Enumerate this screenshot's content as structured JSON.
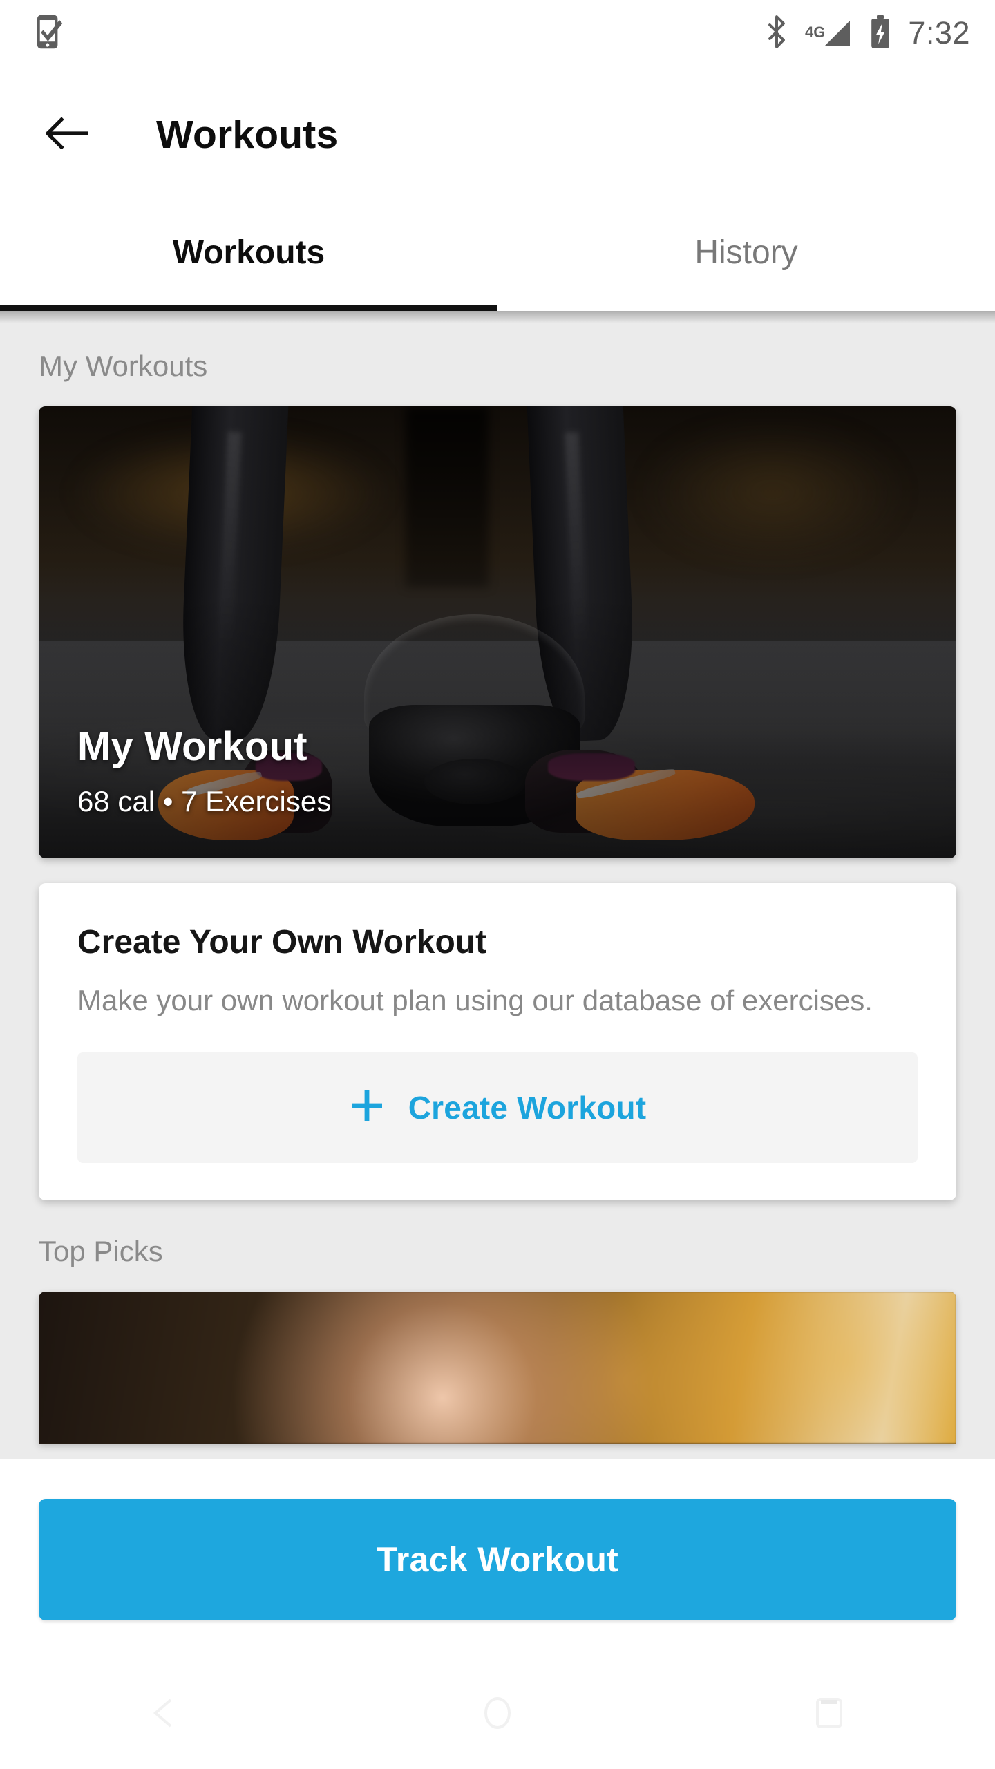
{
  "status_bar": {
    "left_icon": "phone-check-icon",
    "bluetooth_icon": "bluetooth-icon",
    "network_label": "4G",
    "signal_icon": "signal-bars-icon",
    "battery_icon": "battery-charging-icon",
    "time": "7:32"
  },
  "app_bar": {
    "back_icon": "back-arrow-icon",
    "title": "Workouts"
  },
  "tabs": {
    "items": [
      {
        "label": "Workouts",
        "active": true
      },
      {
        "label": "History",
        "active": false
      }
    ]
  },
  "sections": {
    "my_workouts": {
      "header": "My Workouts",
      "card": {
        "title": "My Workout",
        "subtitle": "68 cal • 7 Exercises",
        "calories": "68 cal",
        "exercise_count": "7 Exercises"
      }
    },
    "create": {
      "title": "Create Your Own Workout",
      "description": "Make your own workout plan using our database of exercises.",
      "button_label": "Create Workout",
      "button_icon": "plus-icon"
    },
    "top_picks": {
      "header": "Top Picks"
    }
  },
  "bottom_bar": {
    "primary_button_label": "Track Workout"
  },
  "nav_bar": {
    "back_icon": "nav-back-triangle-icon",
    "home_icon": "nav-home-circle-icon",
    "recents_icon": "nav-recents-square-icon"
  },
  "colors": {
    "accent_blue": "#1ea7de",
    "link_blue": "#1ca4dd",
    "background_gray": "#ebebeb",
    "text_primary": "#0d0d0d",
    "text_secondary": "#8a8a8a",
    "tab_indicator": "#111111",
    "card_white": "#ffffff",
    "button_fill_gray": "#f4f4f4"
  }
}
